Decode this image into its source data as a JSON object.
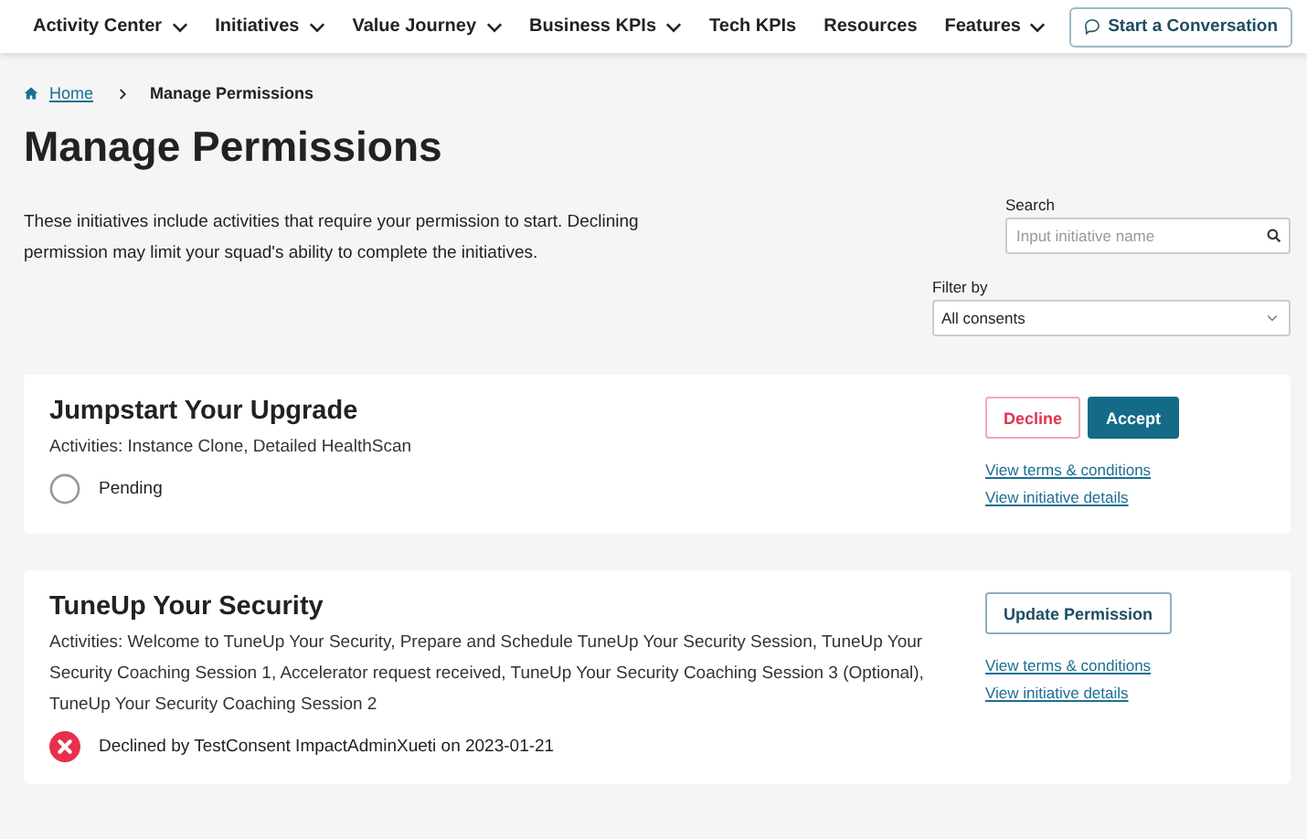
{
  "nav": {
    "items": [
      {
        "label": "Activity Center",
        "dropdown": true
      },
      {
        "label": "Initiatives",
        "dropdown": true
      },
      {
        "label": "Value Journey",
        "dropdown": true
      },
      {
        "label": "Business KPIs",
        "dropdown": true
      },
      {
        "label": "Tech KPIs",
        "dropdown": false
      },
      {
        "label": "Resources",
        "dropdown": false
      },
      {
        "label": "Features",
        "dropdown": true
      }
    ],
    "action": "Start a Conversation"
  },
  "breadcrumb": [
    {
      "label": "Home",
      "link": true
    },
    {
      "label": "Manage Permissions",
      "link": false
    }
  ],
  "title": "Manage Permissions",
  "description": "These initiatives include activities that require your permission to start. Declining permission may limit your squad's ability to complete the initiatives.",
  "search": {
    "label": "Search",
    "placeholder": "Input initiative name"
  },
  "filter": {
    "label": "Filter by",
    "value": "All consents"
  },
  "initiatives": [
    {
      "title": "Jumpstart Your Upgrade",
      "activities": "Activities: Instance Clone, Detailed HealthScan",
      "status": {
        "kind": "pending",
        "text": "Pending"
      },
      "buttons": [
        {
          "label": "Decline",
          "kind": "decline"
        },
        {
          "label": "Accept",
          "kind": "accept"
        }
      ],
      "links": [
        "View terms & conditions",
        "View initiative details"
      ]
    },
    {
      "title": "TuneUp Your Security",
      "activities": "Activities: Welcome to TuneUp Your Security, Prepare and Schedule TuneUp Your Security Session, TuneUp Your Security Coaching Session 1, Accelerator request received, TuneUp Your Security Coaching Session 3 (Optional), TuneUp Your Security Coaching Session 2",
      "status": {
        "kind": "declined",
        "text": "Declined by TestConsent ImpactAdminXueti on 2023-01-21"
      },
      "buttons": [
        {
          "label": "Update Permission",
          "kind": "update"
        }
      ],
      "links": [
        "View terms & conditions",
        "View initiative details"
      ]
    }
  ]
}
